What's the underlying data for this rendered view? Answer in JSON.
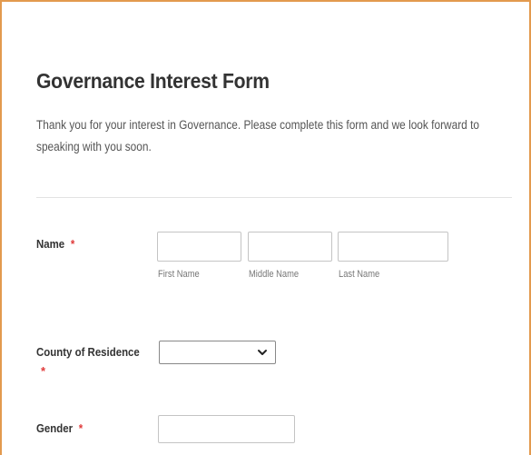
{
  "form": {
    "title": "Governance Interest Form",
    "description": "Thank you for your interest in Governance. Please complete this form and we look forward to speaking with you soon.",
    "required_marker": "*",
    "name_field": {
      "label": "Name",
      "first_name_value": "",
      "first_name_sublabel": "First Name",
      "middle_name_value": "",
      "middle_name_sublabel": "Middle Name",
      "last_name_value": "",
      "last_name_sublabel": "Last Name"
    },
    "county_field": {
      "label": "County of Residence",
      "selected_value": "",
      "icon": "chevron-down-icon"
    },
    "gender_field": {
      "label": "Gender",
      "value": ""
    }
  },
  "colors": {
    "frame_border": "#e39a4e",
    "required": "#e03a3a",
    "title_text": "#333333",
    "body_text": "#555555",
    "input_border": "#c4c4c4"
  }
}
